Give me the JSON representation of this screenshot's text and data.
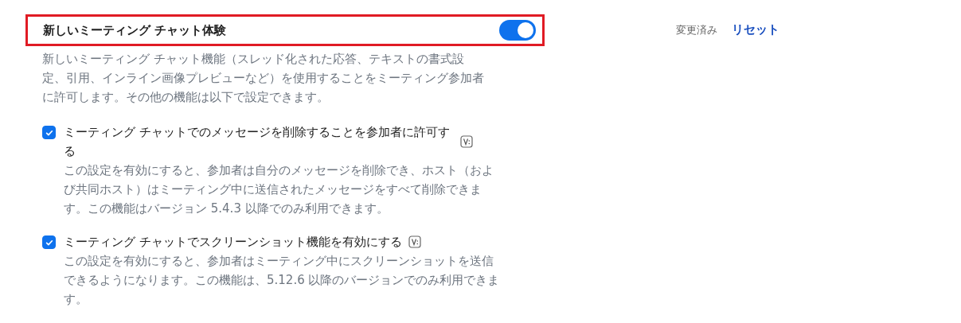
{
  "setting": {
    "title": "新しいミーティング チャット体験",
    "highlighted": true,
    "on": true,
    "description": "新しいミーティング チャット機能（スレッド化された応答、テキストの書式設定、引用、インライン画像プレビューなど）を使用することをミーティング参加者に許可します。その他の機能は以下で設定できます。",
    "options": [
      {
        "label": "ミーティング チャットでのメッセージを削除することを参加者に許可する",
        "checked": true,
        "description": "この設定を有効にすると、参加者は自分のメッセージを削除でき、ホスト（および共同ホスト）はミーティング中に送信されたメッセージをすべて削除できます。この機能はバージョン 5.4.3 以降でのみ利用できます。"
      },
      {
        "label": "ミーティング チャットでスクリーンショット機能を有効にする",
        "checked": true,
        "description": "この設定を有効にすると、参加者はミーティング中にスクリーンショットを送信できるようになります。この機能は、5.12.6 以降のバージョンでのみ利用できます。"
      }
    ]
  },
  "status": {
    "modified": "変更済み",
    "reset": "リセット"
  }
}
